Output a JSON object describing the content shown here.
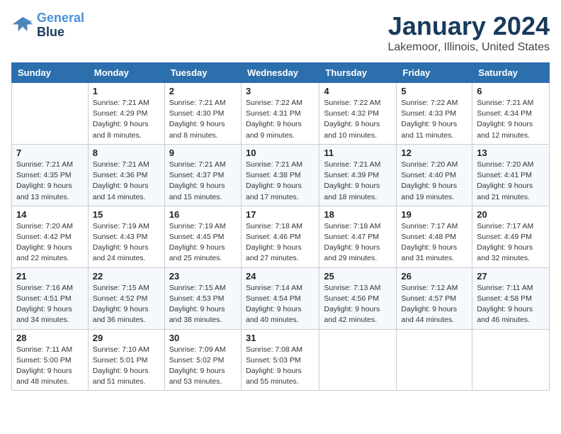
{
  "header": {
    "logo": {
      "line1": "General",
      "line2": "Blue"
    },
    "title": "January 2024",
    "subtitle": "Lakemoor, Illinois, United States"
  },
  "weekdays": [
    "Sunday",
    "Monday",
    "Tuesday",
    "Wednesday",
    "Thursday",
    "Friday",
    "Saturday"
  ],
  "weeks": [
    [
      {
        "day": "",
        "info": ""
      },
      {
        "day": "1",
        "info": "Sunrise: 7:21 AM\nSunset: 4:29 PM\nDaylight: 9 hours\nand 8 minutes."
      },
      {
        "day": "2",
        "info": "Sunrise: 7:21 AM\nSunset: 4:30 PM\nDaylight: 9 hours\nand 8 minutes."
      },
      {
        "day": "3",
        "info": "Sunrise: 7:22 AM\nSunset: 4:31 PM\nDaylight: 9 hours\nand 9 minutes."
      },
      {
        "day": "4",
        "info": "Sunrise: 7:22 AM\nSunset: 4:32 PM\nDaylight: 9 hours\nand 10 minutes."
      },
      {
        "day": "5",
        "info": "Sunrise: 7:22 AM\nSunset: 4:33 PM\nDaylight: 9 hours\nand 11 minutes."
      },
      {
        "day": "6",
        "info": "Sunrise: 7:21 AM\nSunset: 4:34 PM\nDaylight: 9 hours\nand 12 minutes."
      }
    ],
    [
      {
        "day": "7",
        "info": "Sunrise: 7:21 AM\nSunset: 4:35 PM\nDaylight: 9 hours\nand 13 minutes."
      },
      {
        "day": "8",
        "info": "Sunrise: 7:21 AM\nSunset: 4:36 PM\nDaylight: 9 hours\nand 14 minutes."
      },
      {
        "day": "9",
        "info": "Sunrise: 7:21 AM\nSunset: 4:37 PM\nDaylight: 9 hours\nand 15 minutes."
      },
      {
        "day": "10",
        "info": "Sunrise: 7:21 AM\nSunset: 4:38 PM\nDaylight: 9 hours\nand 17 minutes."
      },
      {
        "day": "11",
        "info": "Sunrise: 7:21 AM\nSunset: 4:39 PM\nDaylight: 9 hours\nand 18 minutes."
      },
      {
        "day": "12",
        "info": "Sunrise: 7:20 AM\nSunset: 4:40 PM\nDaylight: 9 hours\nand 19 minutes."
      },
      {
        "day": "13",
        "info": "Sunrise: 7:20 AM\nSunset: 4:41 PM\nDaylight: 9 hours\nand 21 minutes."
      }
    ],
    [
      {
        "day": "14",
        "info": "Sunrise: 7:20 AM\nSunset: 4:42 PM\nDaylight: 9 hours\nand 22 minutes."
      },
      {
        "day": "15",
        "info": "Sunrise: 7:19 AM\nSunset: 4:43 PM\nDaylight: 9 hours\nand 24 minutes."
      },
      {
        "day": "16",
        "info": "Sunrise: 7:19 AM\nSunset: 4:45 PM\nDaylight: 9 hours\nand 25 minutes."
      },
      {
        "day": "17",
        "info": "Sunrise: 7:18 AM\nSunset: 4:46 PM\nDaylight: 9 hours\nand 27 minutes."
      },
      {
        "day": "18",
        "info": "Sunrise: 7:18 AM\nSunset: 4:47 PM\nDaylight: 9 hours\nand 29 minutes."
      },
      {
        "day": "19",
        "info": "Sunrise: 7:17 AM\nSunset: 4:48 PM\nDaylight: 9 hours\nand 31 minutes."
      },
      {
        "day": "20",
        "info": "Sunrise: 7:17 AM\nSunset: 4:49 PM\nDaylight: 9 hours\nand 32 minutes."
      }
    ],
    [
      {
        "day": "21",
        "info": "Sunrise: 7:16 AM\nSunset: 4:51 PM\nDaylight: 9 hours\nand 34 minutes."
      },
      {
        "day": "22",
        "info": "Sunrise: 7:15 AM\nSunset: 4:52 PM\nDaylight: 9 hours\nand 36 minutes."
      },
      {
        "day": "23",
        "info": "Sunrise: 7:15 AM\nSunset: 4:53 PM\nDaylight: 9 hours\nand 38 minutes."
      },
      {
        "day": "24",
        "info": "Sunrise: 7:14 AM\nSunset: 4:54 PM\nDaylight: 9 hours\nand 40 minutes."
      },
      {
        "day": "25",
        "info": "Sunrise: 7:13 AM\nSunset: 4:56 PM\nDaylight: 9 hours\nand 42 minutes."
      },
      {
        "day": "26",
        "info": "Sunrise: 7:12 AM\nSunset: 4:57 PM\nDaylight: 9 hours\nand 44 minutes."
      },
      {
        "day": "27",
        "info": "Sunrise: 7:11 AM\nSunset: 4:58 PM\nDaylight: 9 hours\nand 46 minutes."
      }
    ],
    [
      {
        "day": "28",
        "info": "Sunrise: 7:11 AM\nSunset: 5:00 PM\nDaylight: 9 hours\nand 48 minutes."
      },
      {
        "day": "29",
        "info": "Sunrise: 7:10 AM\nSunset: 5:01 PM\nDaylight: 9 hours\nand 51 minutes."
      },
      {
        "day": "30",
        "info": "Sunrise: 7:09 AM\nSunset: 5:02 PM\nDaylight: 9 hours\nand 53 minutes."
      },
      {
        "day": "31",
        "info": "Sunrise: 7:08 AM\nSunset: 5:03 PM\nDaylight: 9 hours\nand 55 minutes."
      },
      {
        "day": "",
        "info": ""
      },
      {
        "day": "",
        "info": ""
      },
      {
        "day": "",
        "info": ""
      }
    ]
  ]
}
